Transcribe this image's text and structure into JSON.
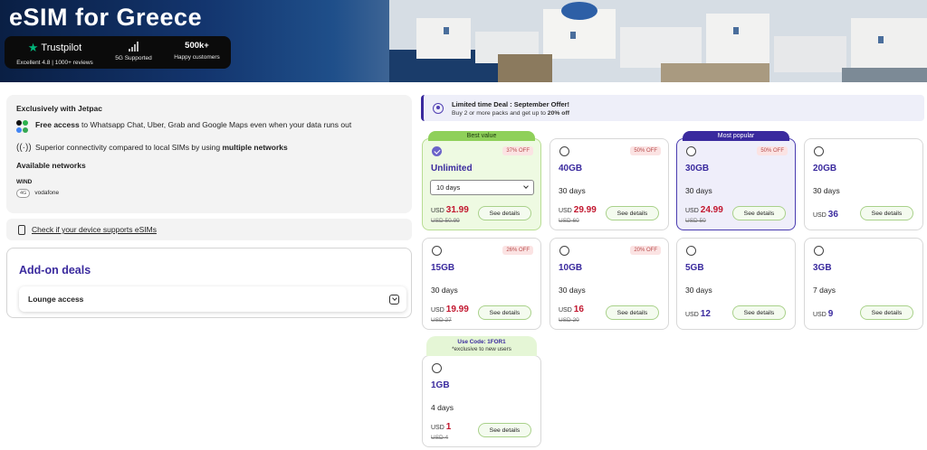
{
  "hero": {
    "title": "eSIM for Greece",
    "trustpilot": {
      "name": "Trustpilot",
      "caption": "Excellent 4.8 | 1000+ reviews"
    },
    "network": {
      "caption": "5G Supported"
    },
    "customers": {
      "value": "500k+",
      "caption": "Happy customers"
    }
  },
  "info": {
    "exclusive": "Exclusively with Jetpac",
    "free_access_bold": "Free access",
    "free_access_rest": " to Whatsapp Chat, Uber, Grab and Google Maps even when your data runs out",
    "connectivity_pre": "Superior connectivity compared to local SIMs by using ",
    "connectivity_bold": "multiple networks",
    "available": "Available networks",
    "operator": "WIND",
    "badge": "4G",
    "operator_sub": "vodafone"
  },
  "check": {
    "label": "Check if your device supports eSIMs"
  },
  "addon": {
    "title": "Add-on deals",
    "lounge": "Lounge access"
  },
  "promo": {
    "title": "Limited time Deal : September Offer!",
    "sub_pre": "Buy 2 or more packs and get up to ",
    "sub_bold": "20% off"
  },
  "plans": [
    {
      "ribbon": "Best value",
      "off": "37% OFF",
      "name": "Unlimited",
      "select": "10 days",
      "currency": "USD",
      "price": "31.99",
      "old": "USD 50.99",
      "details": "See details"
    },
    {
      "off": "50% OFF",
      "name": "40GB",
      "days": "30 days",
      "currency": "USD",
      "price": "29.99",
      "old": "USD 60",
      "details": "See details"
    },
    {
      "ribbon": "Most popular",
      "off": "50% OFF",
      "name": "30GB",
      "days": "30 days",
      "currency": "USD",
      "price": "24.99",
      "old": "USD 50",
      "details": "See details"
    },
    {
      "name": "20GB",
      "days": "30 days",
      "currency": "USD",
      "price": "36",
      "details": "See details"
    },
    {
      "off": "26% OFF",
      "name": "15GB",
      "days": "30 days",
      "currency": "USD",
      "price": "19.99",
      "old": "USD 27",
      "details": "See details"
    },
    {
      "off": "20% OFF",
      "name": "10GB",
      "days": "30 days",
      "currency": "USD",
      "price": "16",
      "old": "USD 20",
      "details": "See details"
    },
    {
      "name": "5GB",
      "days": "30 days",
      "currency": "USD",
      "price": "12",
      "details": "See details"
    },
    {
      "name": "3GB",
      "days": "7 days",
      "currency": "USD",
      "price": "9",
      "details": "See details"
    },
    {
      "code": "Use Code: 1FOR1",
      "code_sub": "*exclusive to new users",
      "name": "1GB",
      "days": "4 days",
      "currency": "USD",
      "price": "1",
      "old": "USD 4",
      "details": "See details"
    }
  ],
  "colors": {
    "brand": "#3a2a9e",
    "sale": "#c2172f",
    "best": "#8fd05a"
  }
}
